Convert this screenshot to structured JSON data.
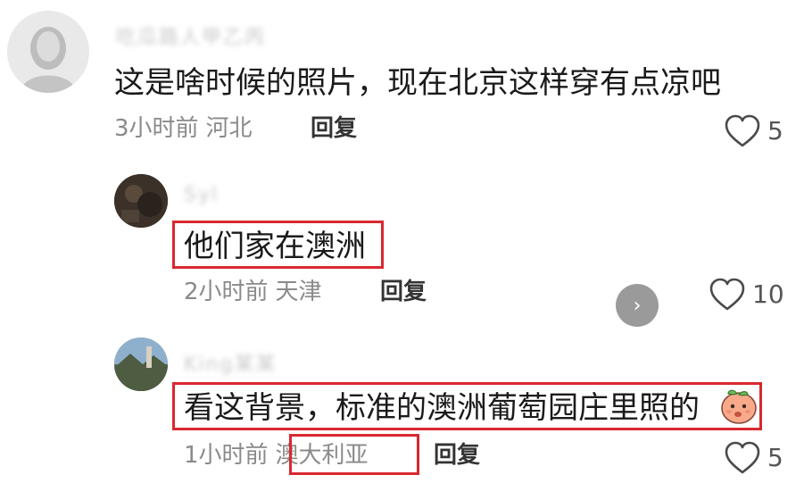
{
  "comments": [
    {
      "username": "吃瓜路人甲乙丙",
      "text": "这是啥时候的照片，现在北京这样穿有点凉吧",
      "time": "3小时前",
      "location": "河北",
      "reply_label": "回复",
      "likes": "5"
    },
    {
      "username": "Syl",
      "text": "他们家在澳洲",
      "time": "2小时前",
      "location": "天津",
      "reply_label": "回复",
      "likes": "10"
    },
    {
      "username": "King某某",
      "text": "看这背景，标准的澳洲葡萄园庄里照的",
      "time": "1小时前",
      "location": "澳大利亚",
      "reply_label": "回复",
      "likes": "5"
    }
  ],
  "next_button_glyph": "›",
  "colors": {
    "highlight": "#d9282f",
    "meta_text": "#8a8a8a",
    "body_text": "#1a1a1a"
  },
  "icons": {
    "like": "heart-outline-icon",
    "next": "chevron-right-icon",
    "emoji": "peach-face-emoji-icon"
  }
}
